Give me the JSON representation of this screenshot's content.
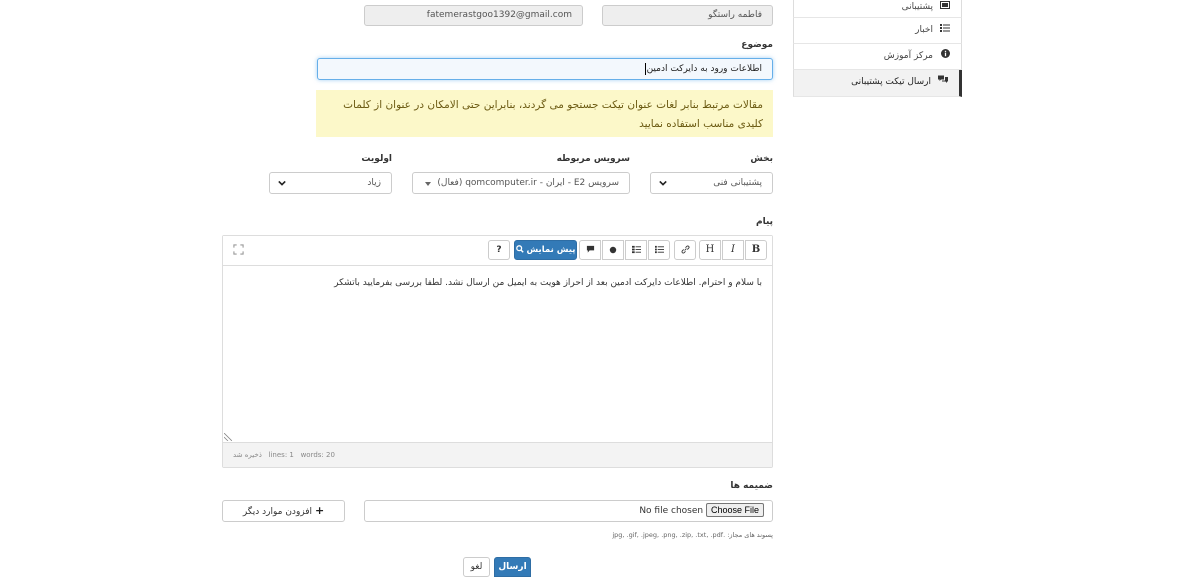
{
  "form": {
    "name_value": "فاطمه راستگو",
    "email_value": "fatemerastgoo1392@gmail.com",
    "subject_label": "موضوع",
    "subject_value": "اطلاعات ورود به دایرکت ادمین",
    "kb_alert": "مقالات مرتبط بنابر لغات عنوان تیکت جستجو می گردند، بنابراین حتی الامکان در عنوان از کلمات کلیدی مناسب استفاده نمایید",
    "department_label": "بخش",
    "department_value": "پشتیبانی فنی",
    "service_label": "سرویس مربوطه",
    "service_value": "سرویس E2 - ایران - qomcomputer.ir (فعال)",
    "priority_label": "اولویت",
    "priority_value": "زیاد",
    "message_label": "پیام",
    "message_body": "با سلام و احترام. اطلاعات دایرکت ادمین بعد از احراز هویت به ایمیل من ارسال نشد. لطفا بررسی بفرمایید باتشکر",
    "attachments_label": "ضمیمه ها",
    "file_button": "Choose File",
    "file_status": "No file chosen",
    "add_more_label": "افزودن موارد دیگر",
    "allowed_ext": "پسوند های مجاز: .jpg, .gif, .jpeg, .png, .zip, .txt, .pdf",
    "submit_label": "ارسال",
    "cancel_label": "لغو"
  },
  "editor": {
    "bold": "B",
    "italic": "I",
    "heading": "H",
    "preview_label": "پیش نمایش",
    "help": "?",
    "status_lines": "lines: 1",
    "status_words": "words: 20",
    "status_saved": "ذخیره شد"
  },
  "sidebar": {
    "items": [
      {
        "label": "پشتیبانی",
        "icon": "ticket-icon"
      },
      {
        "label": "اخبار",
        "icon": "list-icon"
      },
      {
        "label": "مرکز آموزش",
        "icon": "info-icon"
      },
      {
        "label": "ارسال تیکت پشتیبانی",
        "icon": "comments-icon"
      }
    ]
  },
  "colors": {
    "primary": "#337ab7",
    "alert_bg": "#fcf8c9",
    "focus": "#66afe9"
  }
}
